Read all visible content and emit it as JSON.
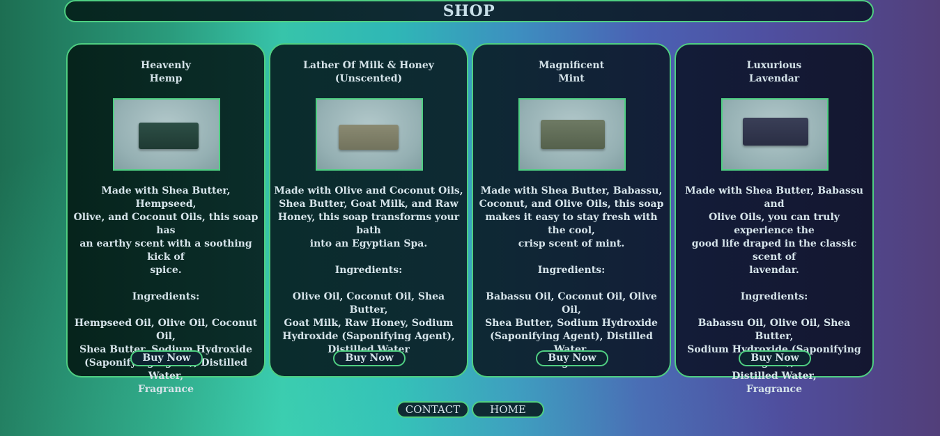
{
  "header": {
    "title": "SHOP"
  },
  "products": [
    {
      "title": "Heavenly\nHemp",
      "description": "Made with Shea Butter, Hempseed,\nOlive, and Coconut Oils, this soap has\nan earthy scent with a soothing kick of\nspice.\n\nIngredients:\n\nHempseed Oil, Olive Oil, Coconut Oil,\nShea Butter, Sodium Hydroxide\n(Saponifying Agent), Distilled Water,\nFragrance",
      "button": "Buy Now",
      "soap_color": "#2d4f46"
    },
    {
      "title": "Lather Of Milk & Honey\n(Unscented)",
      "description": "Made with Olive and Coconut Oils,\nShea Butter, Goat Milk, and Raw\nHoney, this soap transforms your bath\ninto an Egyptian Spa.\n\nIngredients:\n\nOlive Oil, Coconut Oil, Shea Butter,\nGoat Milk, Raw Honey, Sodium\nHydroxide (Saponifying Agent),\nDistilled Water",
      "button": "Buy Now",
      "soap_color": "#8a8a72"
    },
    {
      "title": "Magnificent\nMint",
      "description": "Made with Shea Butter, Babassu,\nCoconut, and Olive Oils, this soap\nmakes it easy to stay fresh with the cool,\ncrisp scent of mint.\n\nIngredients:\n\nBabassu Oil, Coconut Oil, Olive Oil,\nShea Butter, Sodium Hydroxide\n(Saponifying Agent), Distilled Water,\nFragrance",
      "button": "Buy Now",
      "soap_color": "#6e7a64"
    },
    {
      "title": "Luxurious\nLavendar",
      "description": "Made with Shea Butter, Babassu and\nOlive Oils, you can truly experience the\ngood life draped in the classic scent of\nlavendar.\n\nIngredients:\n\nBabassu Oil, Olive Oil, Shea Butter,\nSodium Hydroxide (Saponifying Agent),\nDistilled Water,\nFragrance",
      "button": "Buy Now",
      "soap_color": "#3a3f57"
    }
  ],
  "nav": {
    "contact": "CONTACT",
    "home": "HOME"
  },
  "colors": {
    "accent_border": "#4fcf82",
    "text": "#d6e4ea"
  }
}
